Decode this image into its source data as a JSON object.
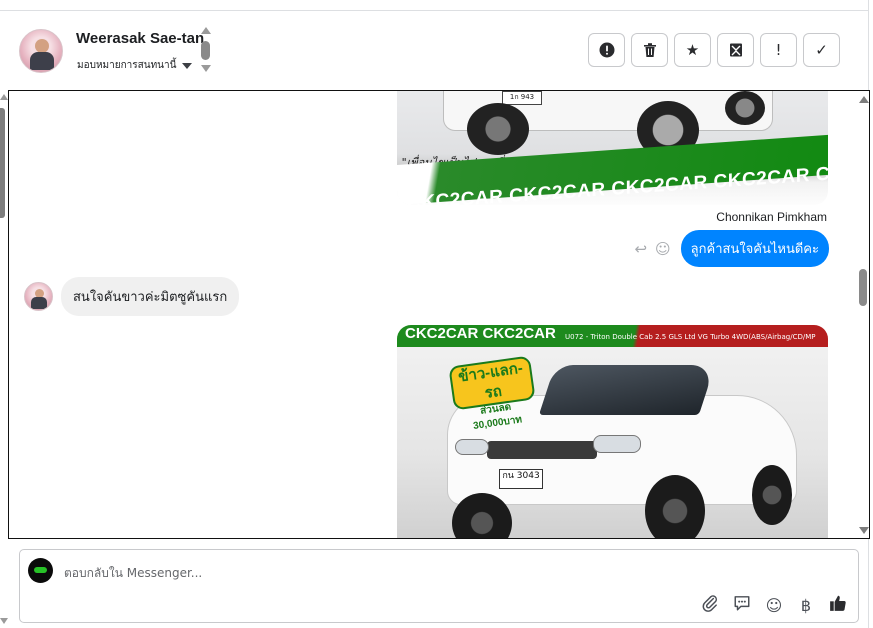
{
  "header": {
    "contact_name": "Weerasak Sae-tan",
    "assign_label": "มอบหมายการสนทนานี้",
    "actions": [
      {
        "name": "report-button",
        "icon": "exclamation-circle-icon",
        "glyph": "!"
      },
      {
        "name": "delete-button",
        "icon": "trash-icon",
        "glyph": ""
      },
      {
        "name": "star-button",
        "icon": "star-icon",
        "glyph": "★"
      },
      {
        "name": "archive-button",
        "icon": "archive-icon",
        "glyph": ""
      },
      {
        "name": "important-button",
        "icon": "exclamation-icon",
        "glyph": "!"
      },
      {
        "name": "done-button",
        "icon": "check-icon",
        "glyph": "✓"
      }
    ]
  },
  "chat": {
    "image1": {
      "contact_line": "\"เพื่อนไขเป็นไปตามที่บริษัทฯ กำหนด โทรสอบถามเพิ่มเติมได้ที่ 088-5577932",
      "plate": "1ก 943",
      "brand_strip": "CKC2CAR CKC2CAR CKC2CAR CKC2CAR CKC2"
    },
    "outgoing": {
      "sender": "Chonnikan Pimkham",
      "text": "ลูกค้าสนใจคันไหนดีคะ"
    },
    "incoming": {
      "text": "สนใจคันขาวค่ะมิตซูคันแรก"
    },
    "image2": {
      "brand_strip": "CKC2CAR CKC2CAR",
      "model_line": "U072 - Triton Double Cab 2.5 GLS Ltd VG Turbo 4WD(ABS/Airbag/CD/MP",
      "promo_line1": "ข้าว-แลก-รถ",
      "promo_line2": "ส่วนลด 30,000บาท",
      "plate": "กน 3043"
    }
  },
  "composer": {
    "placeholder": "ตอบกลับใน Messenger..."
  },
  "colors": {
    "accent": "#0084ff",
    "incoming_bubble": "#f0f0f0",
    "brand_green": "#128a12"
  }
}
